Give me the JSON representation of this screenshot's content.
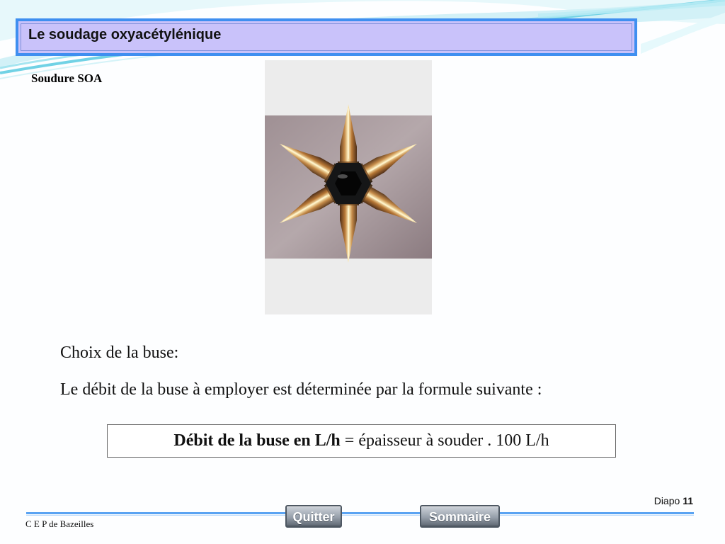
{
  "slide": {
    "title": "Le soudage oxyacétylénique",
    "subtitle": "Soudure SOA",
    "body": {
      "line_1": "Choix de la buse:",
      "line_2": "Le débit de la buse à employer est déterminée par la formule suivante :"
    },
    "formula": {
      "label": "Débit de la buse en L/h",
      "operator": " = ",
      "expression": "épaisseur à souder . 100 L/h"
    },
    "slide_number": {
      "label": "Diapo",
      "value": "11"
    },
    "footer": {
      "organization": "C E P de Bazeilles"
    },
    "navigation": {
      "quit_label": "Quitter",
      "summary_label": "Sommaire"
    },
    "photo": {
      "icon": "welding-nozzles-photo"
    }
  },
  "colors": {
    "title_border": "#3f8ff0",
    "title_background": "#c9c2fa",
    "wave_accent": "#64cfe2",
    "footer_rule": "#5aa3f2",
    "button_gray": "#969faa"
  }
}
